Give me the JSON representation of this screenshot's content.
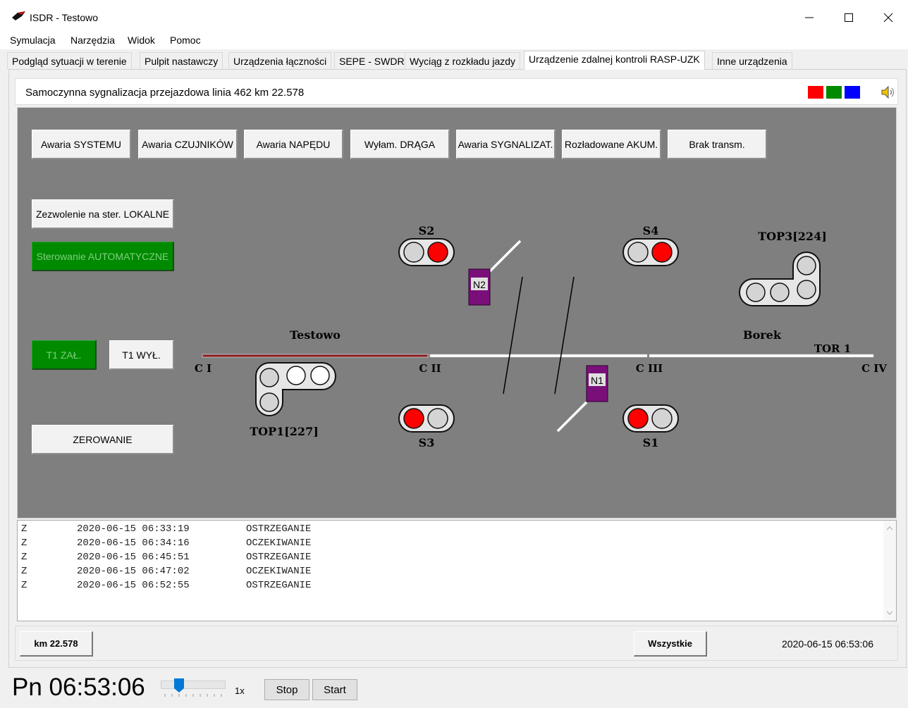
{
  "window": {
    "title": "ISDR - Testowo"
  },
  "menu": [
    "Symulacja",
    "Narzędzia",
    "Widok",
    "Pomoc"
  ],
  "tabs": [
    "Podgląd sytuacji w terenie",
    "Pulpit nastawczy",
    "Urządzenia łączności",
    "SEPE - SWDR",
    "Wyciąg z rozkładu jazdy",
    "Urządzenie zdalnej kontroli RASP-UZK",
    "Inne urządzenia"
  ],
  "active_tab": "Urządzenie zdalnej kontroli RASP-UZK",
  "infobar": {
    "title": "Samoczynna sygnalizacja przejazdowa linia 462 km 22.578"
  },
  "alarms": [
    "Awaria SYSTEMU",
    "Awaria CZUJNIKÓW",
    "Awaria NAPĘDU",
    "Wyłam. DRĄGA",
    "Awaria SYGNALIZAT.",
    "Rozładowane AKUM.",
    "Brak transm."
  ],
  "controls": {
    "local": "Zezwolenie na ster. LOKALNE",
    "auto": "Sterowanie AUTOMATYCZNE",
    "t1_on": "T1 ZAŁ.",
    "t1_off": "T1 WYŁ.",
    "reset": "ZEROWANIE"
  },
  "diagram": {
    "stations": [
      "Testowo",
      "Borek"
    ],
    "track": "TOR 1",
    "sections": [
      "C I",
      "C II",
      "C III",
      "C IV"
    ],
    "signals": [
      "S2",
      "S4",
      "S3",
      "S1"
    ],
    "barriers": [
      "N2",
      "N1"
    ],
    "top_signals": [
      "TOP3[224]",
      "TOP1[227]"
    ]
  },
  "log": [
    {
      "type": "Z",
      "time": "2020-06-15 06:33:19",
      "msg": "OSTRZEGANIE"
    },
    {
      "type": "Z",
      "time": "2020-06-15 06:34:16",
      "msg": "OCZEKIWANIE"
    },
    {
      "type": "Z",
      "time": "2020-06-15 06:45:51",
      "msg": "OSTRZEGANIE"
    },
    {
      "type": "Z",
      "time": "2020-06-15 06:47:02",
      "msg": "OCZEKIWANIE"
    },
    {
      "type": "Z",
      "time": "2020-06-15 06:52:55",
      "msg": "OSTRZEGANIE"
    }
  ],
  "bottom": {
    "km": "km 22.578",
    "all": "Wszystkie",
    "datetime": "2020-06-15 06:53:06"
  },
  "sim": {
    "clock": "Pn 06:53:06",
    "speed": "1x",
    "stop": "Stop",
    "start": "Start"
  },
  "colors": {
    "diagram_bg": "#7f7f7f",
    "active_green": "#008a00",
    "signal_red": "#ff0000",
    "barrier_purple": "#7a0f7a",
    "occupied_track": "#8b1a1a"
  }
}
